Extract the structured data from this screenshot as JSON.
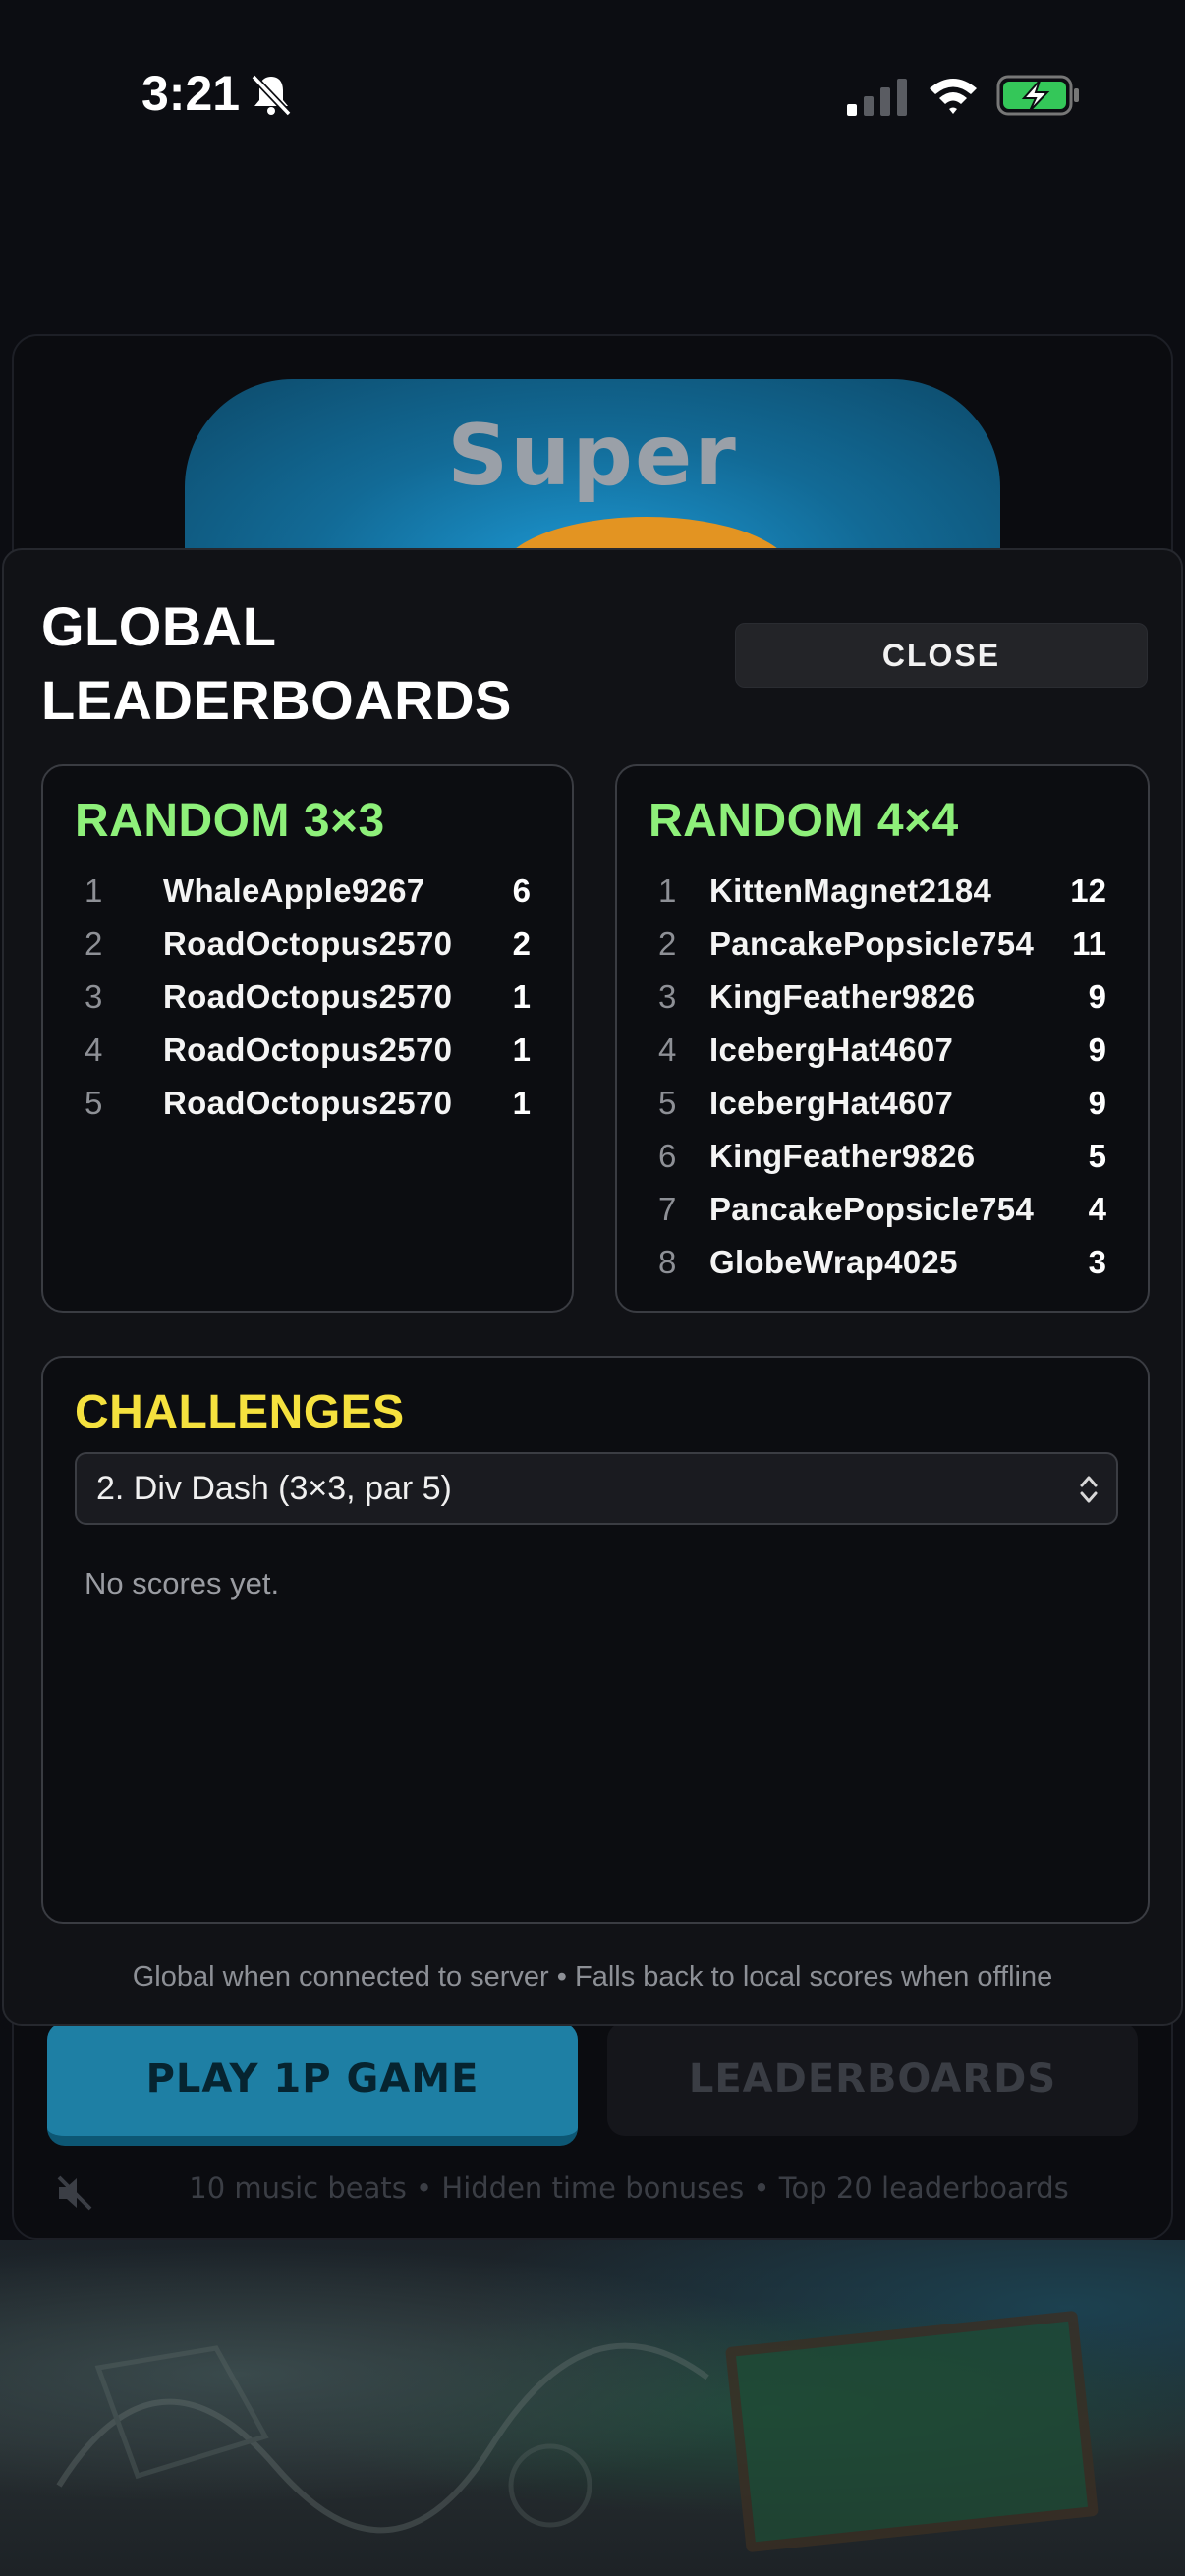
{
  "status_bar": {
    "time": "3:21",
    "icons": [
      "bell-slash-icon",
      "cellular-signal-icon",
      "wifi-icon",
      "battery-charging-icon"
    ]
  },
  "app": {
    "logo_text": "Super",
    "play_button": "PLAY 1P GAME",
    "leaderboards_button": "LEADERBOARDS",
    "footer": "10 music beats • Hidden time bonuses • Top 20 leaderboards",
    "sound_icon": "speaker-muted-icon"
  },
  "modal": {
    "title_line1": "GLOBAL",
    "title_line2": "LEADERBOARDS",
    "close_label": "CLOSE",
    "footer": "Global when connected to server • Falls back to local scores when offline"
  },
  "random3": {
    "heading": "RANDOM 3×3",
    "rows": [
      {
        "rank": "1",
        "name": "WhaleApple9267",
        "score": "6"
      },
      {
        "rank": "2",
        "name": "RoadOctopus2570",
        "score": "2"
      },
      {
        "rank": "3",
        "name": "RoadOctopus2570",
        "score": "1"
      },
      {
        "rank": "4",
        "name": "RoadOctopus2570",
        "score": "1"
      },
      {
        "rank": "5",
        "name": "RoadOctopus2570",
        "score": "1"
      }
    ]
  },
  "random4": {
    "heading": "RANDOM 4×4",
    "rows": [
      {
        "rank": "1",
        "name": "KittenMagnet2184",
        "score": "12"
      },
      {
        "rank": "2",
        "name": "PancakePopsicle754",
        "score": "11"
      },
      {
        "rank": "3",
        "name": "KingFeather9826",
        "score": "9"
      },
      {
        "rank": "4",
        "name": "IcebergHat4607",
        "score": "9"
      },
      {
        "rank": "5",
        "name": "IcebergHat4607",
        "score": "9"
      },
      {
        "rank": "6",
        "name": "KingFeather9826",
        "score": "5"
      },
      {
        "rank": "7",
        "name": "PancakePopsicle754",
        "score": "4"
      },
      {
        "rank": "8",
        "name": "GlobeWrap4025",
        "score": "3"
      }
    ]
  },
  "challenges": {
    "heading": "CHALLENGES",
    "selected": "2. Div Dash (3×3, par 5)",
    "empty_message": "No scores yet."
  },
  "colors": {
    "green_heading": "#8ef07a",
    "yellow_heading": "#f5e13e",
    "play_button": "#1e7fa4"
  }
}
